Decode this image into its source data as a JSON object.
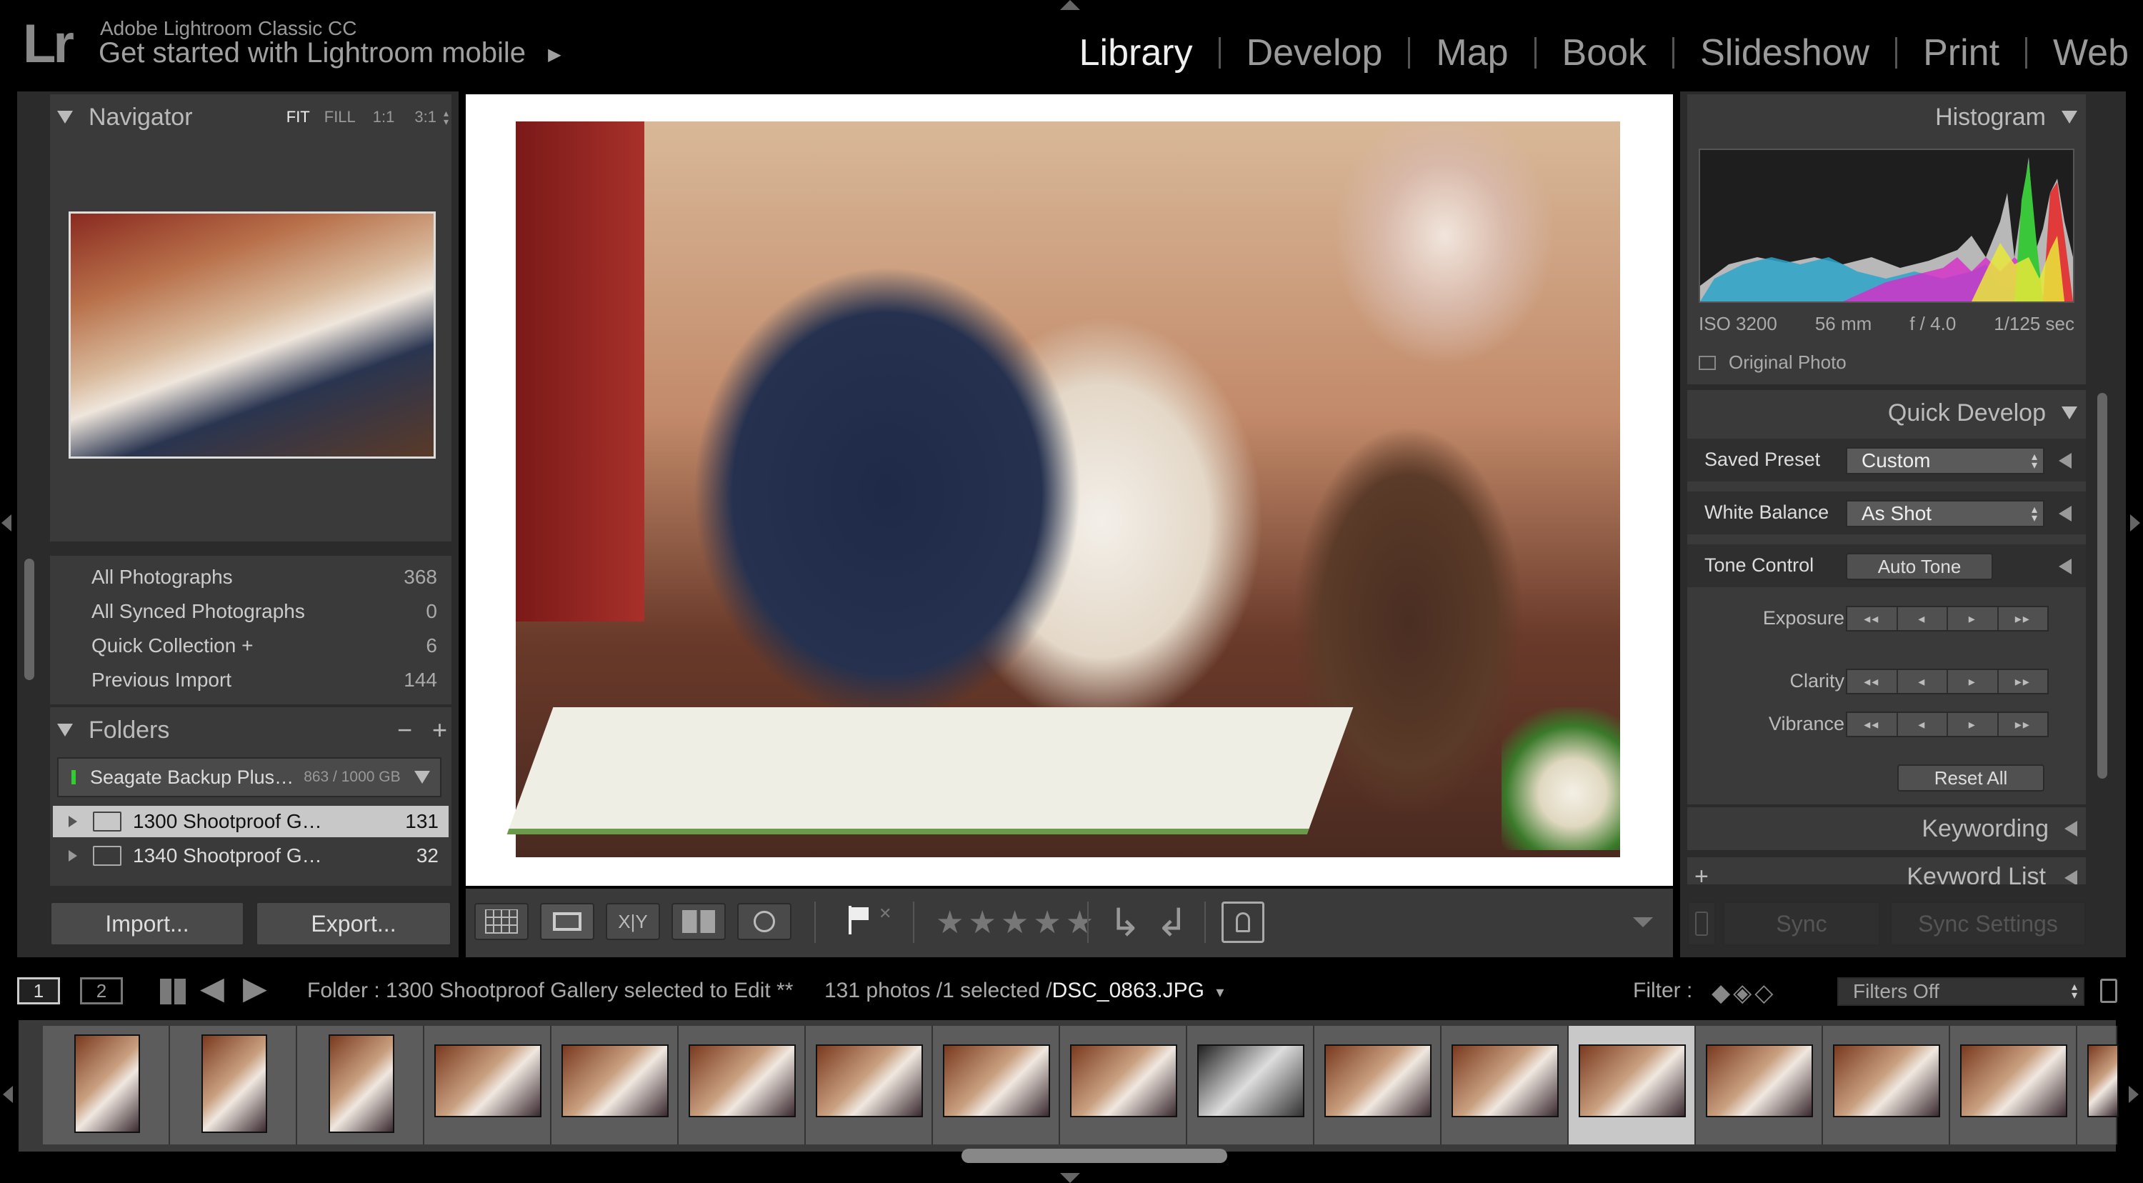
{
  "app": {
    "logo": "Lr",
    "title": "Adobe Lightroom Classic CC",
    "subtitle": "Get started with Lightroom mobile",
    "subtitle_arrow": "▶"
  },
  "modules": [
    "Library",
    "Develop",
    "Map",
    "Book",
    "Slideshow",
    "Print",
    "Web"
  ],
  "active_module": "Library",
  "navigator": {
    "title": "Navigator",
    "zoom_options": [
      "FIT",
      "FILL",
      "1:1",
      "3:1"
    ],
    "selected_zoom": "FIT"
  },
  "catalog": [
    {
      "label": "All Photographs",
      "count": "368"
    },
    {
      "label": "All Synced Photographs",
      "count": "0"
    },
    {
      "label": "Quick Collection +",
      "count": "6"
    },
    {
      "label": "Previous Import",
      "count": "144"
    }
  ],
  "folders": {
    "title": "Folders",
    "minus": "−",
    "plus": "+",
    "volume": {
      "name": "Seagate Backup Plus…",
      "usage": "863 / 1000 GB"
    },
    "items": [
      {
        "name": "1300 Shootproof G…",
        "count": "131",
        "selected": true
      },
      {
        "name": "1340 Shootproof G…",
        "count": "32",
        "selected": false
      }
    ]
  },
  "left_buttons": {
    "import": "Import...",
    "export": "Export..."
  },
  "histogram": {
    "title": "Histogram",
    "iso": "ISO 3200",
    "focal": "56 mm",
    "aperture": "f / 4.0",
    "shutter": "1/125 sec",
    "original_photo": "Original Photo"
  },
  "quick_develop": {
    "title": "Quick Develop",
    "saved_preset_label": "Saved Preset",
    "saved_preset_value": "Custom",
    "white_balance_label": "White Balance",
    "white_balance_value": "As Shot",
    "tone_control_label": "Tone Control",
    "auto_tone": "Auto Tone",
    "exposure": "Exposure",
    "clarity": "Clarity",
    "vibrance": "Vibrance",
    "stepper": [
      "◂◂",
      "◂",
      "▸",
      "▸▸"
    ],
    "reset_all": "Reset All"
  },
  "right_panels": {
    "keywording": "Keywording",
    "keyword_list": "Keyword List",
    "plus": "+"
  },
  "sync": {
    "sync": "Sync",
    "sync_settings": "Sync Settings"
  },
  "toolbar": {
    "flag_reject": "✕"
  },
  "filmstrip_bar": {
    "screen1": "1",
    "screen2": "2",
    "source": "Folder : 1300 Shootproof Gallery selected to Edit **",
    "count": "131 photos /1 selected /",
    "filename": "DSC_0863.JPG",
    "filename_arrow": "▾",
    "filter_label": "Filter :",
    "filter_value": "Filters Off"
  },
  "colors": {
    "background": "#000000",
    "panel": "#3a3a3a",
    "active_text": "#f0f0f0",
    "selected_row": "#c8c8c8"
  }
}
